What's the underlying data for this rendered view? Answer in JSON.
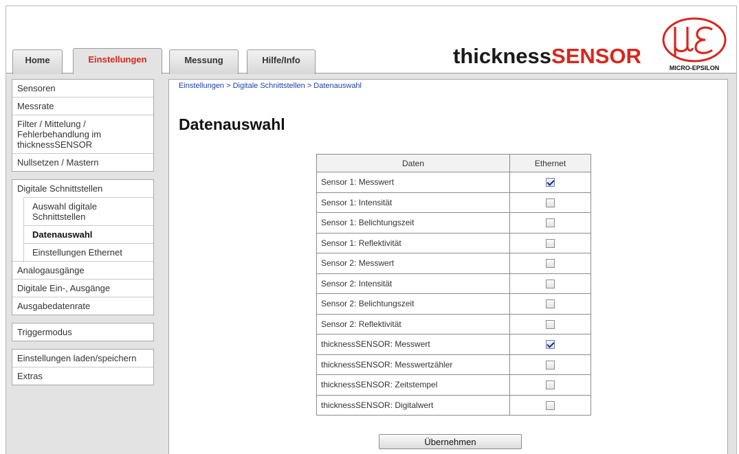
{
  "tabs": [
    {
      "label": "Home"
    },
    {
      "label": "Einstellungen"
    },
    {
      "label": "Messung"
    },
    {
      "label": "Hilfe/Info"
    }
  ],
  "active_tab": "Einstellungen",
  "brand": {
    "part1": "thickness",
    "part2": "SENSOR"
  },
  "logo": {
    "text": "MICRO-EPSILON",
    "icon": "micro-epsilon-logo",
    "color": "#d9261c"
  },
  "sidebar": {
    "group1": [
      "Sensoren",
      "Messrate",
      "Filter / Mittelung / Fehlerbehandlung im thicknessSENSOR",
      "Nullsetzen / Mastern"
    ],
    "group2": [
      "Digitale Schnittstellen",
      "Auswahl digitale Schnittstellen",
      "Datenauswahl",
      "Einstellungen Ethernet",
      "Analogausgänge",
      "Digitale Ein-, Ausgänge",
      "Ausgabedatenrate"
    ],
    "group3": [
      "Triggermodus"
    ],
    "group4": [
      "Einstellungen laden/speichern",
      "Extras"
    ]
  },
  "breadcrumb": "Einstellungen > Digitale Schnittstellen > Datenauswahl",
  "page_title": "Datenauswahl",
  "table": {
    "headers": [
      "Daten",
      "Ethernet"
    ],
    "rows": [
      {
        "label": "Sensor 1: Messwert",
        "ethernet": true
      },
      {
        "label": "Sensor 1: Intensität",
        "ethernet": false
      },
      {
        "label": "Sensor 1: Belichtungszeit",
        "ethernet": false
      },
      {
        "label": "Sensor 1: Reflektivität",
        "ethernet": false
      },
      {
        "label": "Sensor 2: Messwert",
        "ethernet": false
      },
      {
        "label": "Sensor 2: Intensität",
        "ethernet": false
      },
      {
        "label": "Sensor 2: Belichtungszeit",
        "ethernet": false
      },
      {
        "label": "Sensor 2: Reflektivität",
        "ethernet": false
      },
      {
        "label": "thicknessSENSOR: Messwert",
        "ethernet": true
      },
      {
        "label": "thicknessSENSOR: Messwertzähler",
        "ethernet": false
      },
      {
        "label": "thicknessSENSOR: Zeitstempel",
        "ethernet": false
      },
      {
        "label": "thicknessSENSOR: Digitalwert",
        "ethernet": false
      }
    ]
  },
  "apply_button": "Übernehmen",
  "colors": {
    "accent": "#d9261c",
    "link": "#1f3fa8",
    "panel_bg": "#e3e3e3"
  }
}
